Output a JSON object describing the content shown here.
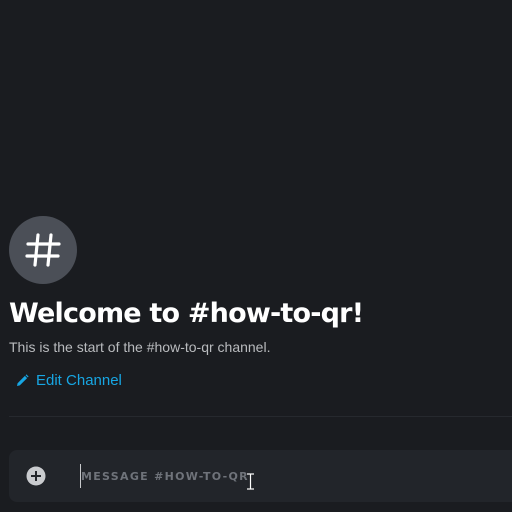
{
  "channel": {
    "welcome_title": "Welcome to #how-to-qr!",
    "welcome_subtitle": "This is the start of the #how-to-qr channel.",
    "edit_label": "Edit Channel",
    "icon": "hash-icon"
  },
  "composer": {
    "placeholder": "MESSAGE #HOW-TO-QR",
    "attach_icon": "plus-circle-icon"
  },
  "colors": {
    "background": "#1a1c20",
    "link": "#17a6e3",
    "title": "#ffffff",
    "subtitle": "#b9bbbe"
  }
}
